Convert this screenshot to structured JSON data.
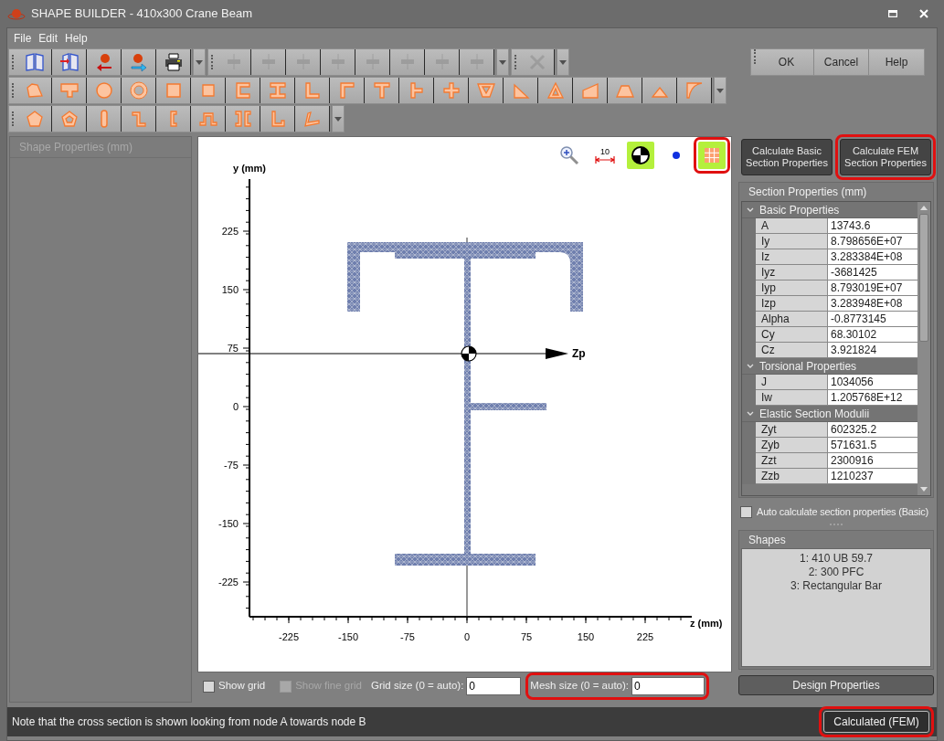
{
  "window": {
    "title": "SHAPE BUILDER - 410x300 Crane Beam"
  },
  "menu": [
    "File",
    "Edit",
    "Help"
  ],
  "toolbar_rows": [
    {
      "strips": [
        {
          "items": [
            {
              "kind": "book",
              "disabled": false
            },
            {
              "kind": "book-import",
              "disabled": false
            },
            {
              "kind": "ball-left",
              "disabled": false
            },
            {
              "kind": "ball-right",
              "disabled": false
            },
            {
              "kind": "printer",
              "disabled": false
            }
          ]
        },
        {
          "items": [
            {
              "kind": "align",
              "disabled": true
            },
            {
              "kind": "align",
              "disabled": true
            },
            {
              "kind": "align",
              "disabled": true
            },
            {
              "kind": "align",
              "disabled": true
            },
            {
              "kind": "align",
              "disabled": true
            },
            {
              "kind": "align",
              "disabled": true
            },
            {
              "kind": "align",
              "disabled": true
            },
            {
              "kind": "align",
              "disabled": true
            }
          ]
        },
        {
          "items": [
            {
              "kind": "delete",
              "disabled": true
            }
          ]
        }
      ]
    },
    {
      "strips": [
        {
          "items": [
            {
              "kind": "polygon",
              "disabled": false
            },
            {
              "kind": "outline",
              "disabled": false
            },
            {
              "kind": "circle",
              "disabled": false
            },
            {
              "kind": "ring",
              "disabled": false
            },
            {
              "kind": "rect",
              "disabled": false
            },
            {
              "kind": "rect-hollow",
              "disabled": false
            },
            {
              "kind": "channel",
              "disabled": false
            },
            {
              "kind": "i-beam",
              "disabled": false
            },
            {
              "kind": "angle",
              "disabled": false
            },
            {
              "kind": "angle-top",
              "disabled": false
            },
            {
              "kind": "tee",
              "disabled": false
            },
            {
              "kind": "tee-side",
              "disabled": false
            },
            {
              "kind": "plus",
              "disabled": false
            },
            {
              "kind": "inv-trapezoid",
              "disabled": false
            },
            {
              "kind": "right-triangle",
              "disabled": false
            },
            {
              "kind": "triangle-hollow",
              "disabled": false
            },
            {
              "kind": "quarter",
              "disabled": false
            },
            {
              "kind": "trapezoid",
              "disabled": false
            },
            {
              "kind": "triangle",
              "disabled": false
            },
            {
              "kind": "fillet",
              "disabled": false
            }
          ]
        }
      ]
    },
    {
      "strips": [
        {
          "items": [
            {
              "kind": "pentagon",
              "disabled": false
            },
            {
              "kind": "pentagon-hollow",
              "disabled": false
            },
            {
              "kind": "rounded-bar",
              "disabled": false
            },
            {
              "kind": "z-section",
              "disabled": false
            },
            {
              "kind": "c-lipped",
              "disabled": false
            },
            {
              "kind": "hat",
              "disabled": false
            },
            {
              "kind": "double-channel",
              "disabled": false
            },
            {
              "kind": "l-lipped",
              "disabled": false
            },
            {
              "kind": "bent",
              "disabled": false
            }
          ]
        }
      ]
    }
  ],
  "dialog_buttons": [
    "OK",
    "Cancel",
    "Help"
  ],
  "left_panel": {
    "title": "Shape Properties (mm)"
  },
  "canvas": {
    "tools": [
      {
        "kind": "zoom",
        "selected": false
      },
      {
        "kind": "dimension",
        "label": "10",
        "selected": false
      },
      {
        "kind": "centroid",
        "selected": true
      },
      {
        "kind": "dot",
        "selected": false
      },
      {
        "kind": "mesh",
        "selected": true
      }
    ],
    "highlighted_tool": {
      "kind": "mesh"
    },
    "y_axis_label": "y (mm)",
    "z_axis_label": "z (mm)",
    "centroid_axis_label": "Zp",
    "y_ticks": [
      "225",
      "150",
      "75",
      "0",
      "-75",
      "-150",
      "-225"
    ],
    "z_ticks": [
      "-225",
      "-150",
      "-75",
      "0",
      "75",
      "150",
      "225"
    ]
  },
  "grid_controls": {
    "show_grid": {
      "label": "Show grid",
      "checked": false,
      "disabled": false
    },
    "show_fine_grid": {
      "label": "Show fine grid",
      "checked": false,
      "disabled": true
    },
    "grid_size": {
      "label": "Grid size (0 = auto):",
      "value": "0",
      "highlighted": false
    },
    "mesh_size": {
      "label": "Mesh size (0 = auto):",
      "value": "0",
      "highlighted": true
    }
  },
  "calc_buttons": [
    {
      "label": "Calculate Basic Section Properties",
      "highlighted": false
    },
    {
      "label": "Calculate FEM Section Properties",
      "highlighted": true
    }
  ],
  "section_properties": {
    "title": "Section Properties (mm)",
    "groups": [
      {
        "name": "Basic Properties",
        "expanded": true,
        "rows": [
          {
            "name": "A",
            "value": "13743.6"
          },
          {
            "name": "Iy",
            "value": "8.798656E+07"
          },
          {
            "name": "Iz",
            "value": "3.283384E+08"
          },
          {
            "name": "Iyz",
            "value": "-3681425"
          },
          {
            "name": "Iyp",
            "value": "8.793019E+07"
          },
          {
            "name": "Izp",
            "value": "3.283948E+08"
          },
          {
            "name": "Alpha",
            "value": "-0.8773145"
          },
          {
            "name": "Cy",
            "value": "68.30102"
          },
          {
            "name": "Cz",
            "value": "3.921824"
          }
        ]
      },
      {
        "name": "Torsional Properties",
        "expanded": true,
        "rows": [
          {
            "name": "J",
            "value": "1034056"
          },
          {
            "name": "Iw",
            "value": "1.205768E+12"
          }
        ]
      },
      {
        "name": "Elastic Section Modulii",
        "expanded": true,
        "rows": [
          {
            "name": "Zyt",
            "value": "602325.2"
          },
          {
            "name": "Zyb",
            "value": "571631.5"
          },
          {
            "name": "Zzt",
            "value": "2300916"
          },
          {
            "name": "Zzb",
            "value": "1210237"
          }
        ]
      }
    ]
  },
  "auto_calc": {
    "label": "Auto calculate section properties (Basic)",
    "checked": false
  },
  "shapes": {
    "title": "Shapes",
    "items": [
      "1: 410 UB 59.7",
      "2: 300 PFC",
      "3: Rectangular Bar"
    ]
  },
  "design_button": "Design Properties",
  "status_bar": {
    "message": "Note that the cross section is shown looking from node A towards node B",
    "status_button": {
      "label": "Calculated (FEM)",
      "highlighted": true
    }
  }
}
